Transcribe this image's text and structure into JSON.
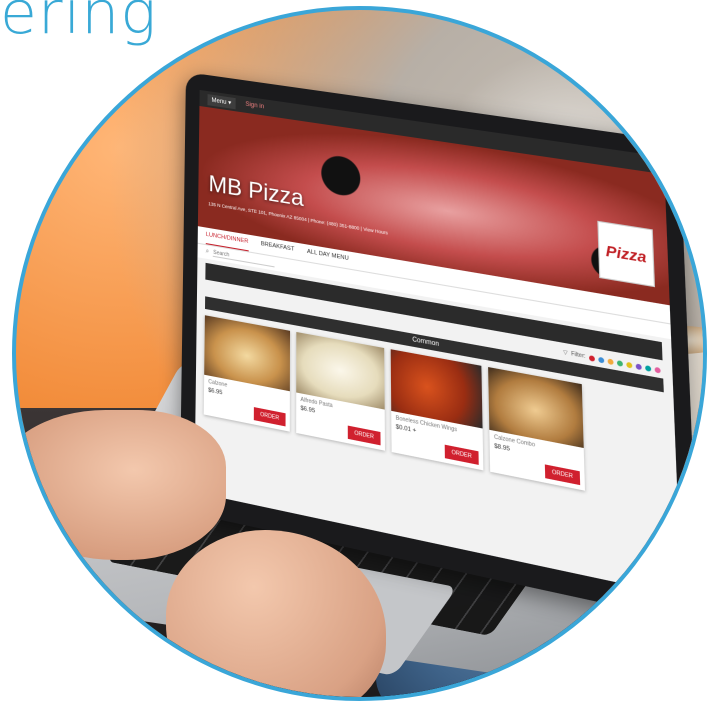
{
  "headline": "ering",
  "browser": {
    "topbar": {
      "menu_label": "Menu ▾",
      "signin_label": "Sign in"
    },
    "restaurant": {
      "name": "MB Pizza",
      "address_line": "135 N Central Ave, STE 101, Phoenix AZ 85004 | Phone: (480) 351-8800 | View Hours",
      "logo_text": "Pizza"
    },
    "tabs": [
      {
        "label": "LUNCH/DINNER",
        "active": true
      },
      {
        "label": "BREAKFAST",
        "active": false
      },
      {
        "label": "ALL DAY MENU",
        "active": false
      }
    ],
    "search": {
      "placeholder": "Search"
    },
    "filter": {
      "label": "Filter:",
      "dot_colors": [
        "#d0202e",
        "#3b8dd6",
        "#f3a93b",
        "#3cb371",
        "#e0c11d",
        "#7b52c8",
        "#00a0a0",
        "#e25e9e"
      ]
    },
    "section_title": "Common",
    "menu_items": [
      {
        "name": "Calzone",
        "price": "$6.95",
        "order_label": "ORDER",
        "image": "calzone"
      },
      {
        "name": "Alfredo Pasta",
        "price": "$6.95",
        "order_label": "ORDER",
        "image": "pasta"
      },
      {
        "name": "Boneless Chicken Wings",
        "price": "$0.01 +",
        "order_label": "ORDER",
        "image": "wings"
      },
      {
        "name": "Calzone Combo",
        "price": "$8.95",
        "order_label": "ORDER",
        "image": "combo"
      }
    ]
  },
  "colors": {
    "frame": "#3aa6d8",
    "accent": "#d0202e",
    "dark_band": "#2b2b2b"
  }
}
